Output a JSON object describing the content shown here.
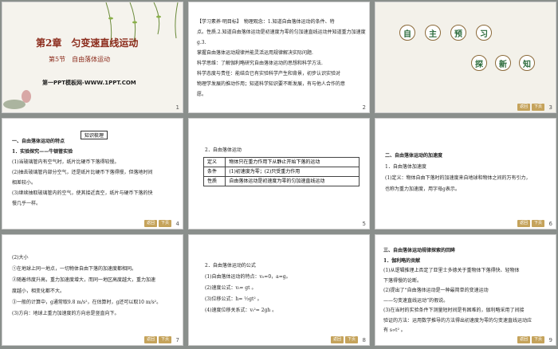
{
  "slides": [
    {
      "num": "1",
      "chapter": "第2章　匀变速直线运动",
      "section": "第5节　自由落体运动",
      "watermark": "第一PPT模板网-WWW.1PPT.COM"
    },
    {
      "num": "2",
      "lines": [
        "【学习素养·明目标】　物理观念：1.知道自由落体运动的条件、特",
        "点。性质.2.知道自由落体运动是初速度为零的匀加速直线运动并知道重力加速度g.3.",
        "掌握自由落体运动规律并能灵活运用规律解决实际问题.",
        "科学思维：了解伽利略研究自由落体运动的思想和科学方法.",
        "科学态度与责任：能结合已有实验科学产生和背景，初步认识实验对",
        "物理学发展的推动作用；知道科学知识要不断发展，有与他人合作的意",
        "愿。"
      ]
    },
    {
      "num": "3",
      "title1": [
        "自",
        "主",
        "预",
        "习"
      ],
      "title2": [
        "探",
        "新",
        "知"
      ]
    },
    {
      "num": "4",
      "label": "知识梳理",
      "lines": [
        "一、自由落体运动的特点",
        "1．实验探究——牛顿管实验",
        "(1)当玻璃管内有空气时，纸片比硬币下落得较慢。",
        "(2)抽去玻璃管内部分空气，还是纸片比硬币下落得慢，但落地时间",
        "相差较小。",
        "(3)继续抽取玻璃管内的空气，使其接近真空，纸片与硬币下落的快",
        "慢几乎一样。"
      ],
      "red": [
        "下落得较慢",
        "较小",
        "几乎一样"
      ]
    },
    {
      "num": "5",
      "heading": "2．自由落体运动",
      "table": [
        [
          "定义",
          "物体只在重力作用下从静止开始下落的运动"
        ],
        [
          "条件",
          "(1)初速度为零；(2)只受重力作用"
        ],
        [
          "性质",
          "自由落体运动是初速度为零的匀加速直线运动"
        ]
      ]
    },
    {
      "num": "6",
      "lines": [
        "二、自由落体运动的加速度",
        "1．自由落体加速度",
        "(1)定义：物体自由下落时的加速度来自地球和物体之间的万有引力，",
        "也称为重力加速度，用字母g表示。"
      ]
    },
    {
      "num": "7",
      "lines": [
        "(2)大小",
        "①在地球上同一地点，一切物体自由下落的加速度都相同。",
        "②随着纬度升高，重力加速度增大，而同一地区高度越大，重力加速",
        "度越小，相变化都不大。",
        "③一般的计算中，g通常取9.8 m/s²，在估算时，g还可以取10 m/s²。",
        "(3)方向：地球上重力加速度的方向总是竖直向下。"
      ]
    },
    {
      "num": "8",
      "lines": [
        "2．自由落体运动的公式",
        "(1)自由落体运动的特点：v₀=0，a=g。",
        "(2)速度公式：vₜ= gt 。",
        "(3)位移公式：h= ½gt² 。",
        "(4)速度位移关系式：vₜ²= 2gh 。"
      ]
    },
    {
      "num": "9",
      "lines": [
        "三、自由落体运动规律探索的回眸",
        "1．伽利略的贡献",
        "(1)从逻辑推理上否定了亚里士多德关于重物体下落得快、轻物体",
        "下落得慢的论断。",
        "(2)提出了“自由落体运动是一种最简单的变速运动",
        "——匀变速直线运动”的假说。",
        "(3)在当时的实验条件下测量短时间是有困难的，伽利略采用了间接",
        "验证的方法：运用数学推导的方法得出初速度为零的匀变速直线运动应",
        "有 s∝t² 。"
      ]
    }
  ],
  "nav": {
    "back": "返回",
    "prev": "上页",
    "next": "下页",
    "home": "首页"
  },
  "colors": {
    "red": "#d22",
    "gold": "#c5a35b",
    "frame": "#8a8f8c"
  }
}
